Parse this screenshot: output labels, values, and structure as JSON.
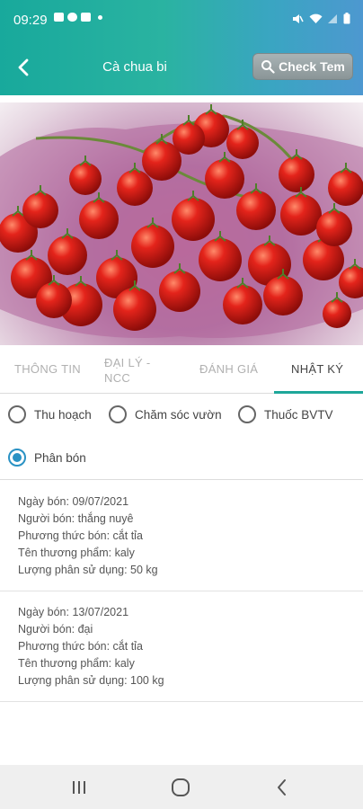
{
  "status_bar": {
    "time": "09:29",
    "left_icons": [
      "image-icon",
      "cloud-icon",
      "message-icon",
      "dot-icon"
    ],
    "right_icons": [
      "mute-icon",
      "wifi-icon",
      "signal-icon",
      "battery-icon"
    ]
  },
  "header": {
    "title": "Cà chua bi",
    "check_button_label": "Check Tem",
    "gradient_colors": [
      "#18a99c",
      "#4d98d0"
    ]
  },
  "hero_image": {
    "subject": "cherry-tomatoes"
  },
  "tabs": [
    {
      "label_line1": "THÔNG TIN",
      "label_line2": ""
    },
    {
      "label_line1": "ĐẠI LÝ -",
      "label_line2": "NCC"
    },
    {
      "label_line1": "ĐÁNH GIÁ",
      "label_line2": ""
    },
    {
      "label_line1": "NHẬT KÝ",
      "label_line2": ""
    }
  ],
  "active_tab_index": 3,
  "filters": [
    {
      "label": "Thu hoạch",
      "checked": false
    },
    {
      "label": "Chăm sóc vườn",
      "checked": false
    },
    {
      "label": "Thuốc BVTV",
      "checked": false
    },
    {
      "label": "Phân bón",
      "checked": true
    }
  ],
  "logs": [
    {
      "date": "Ngày bón: 09/07/2021",
      "person": "Người bón: thắng nuyê",
      "method": "Phương thức bón: cắt tỉa",
      "product": "Tên thương phẩm: kaly",
      "amount": "Lượng phân sử dụng: 50 kg"
    },
    {
      "date": "Ngày bón: 13/07/2021",
      "person": "Người bón: đại",
      "method": "Phương thức bón: cắt tỉa",
      "product": "Tên thương phẩm: kaly",
      "amount": "Lượng phân sử dụng: 100 kg"
    }
  ],
  "colors": {
    "accent": "#1ea79a",
    "radio_checked": "#2a92c4"
  },
  "nav_bar": {
    "buttons": [
      "recents-icon",
      "home-icon",
      "back-nav-icon"
    ]
  }
}
